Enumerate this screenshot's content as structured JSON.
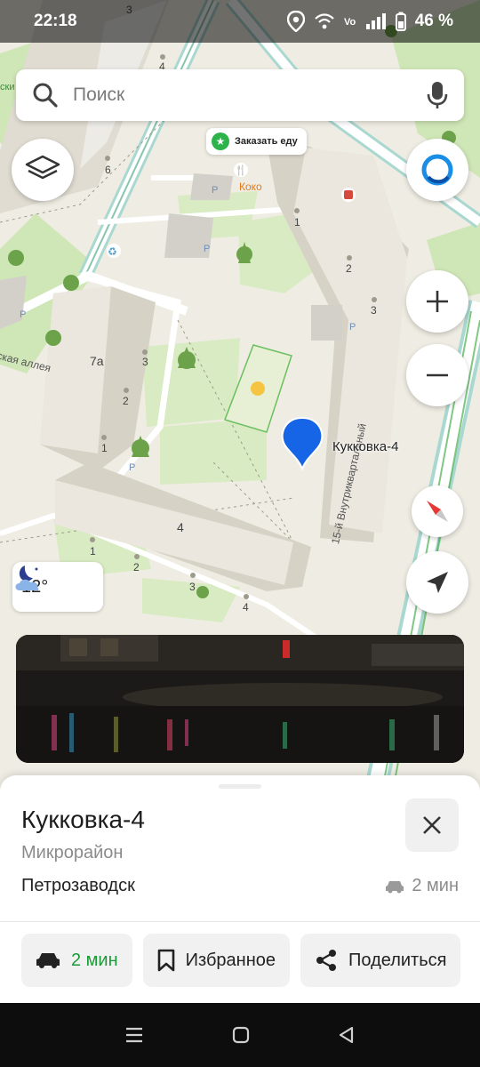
{
  "status_bar": {
    "time": "22:18",
    "battery": "46 %"
  },
  "search": {
    "placeholder": "Поиск"
  },
  "map": {
    "poi_food_chip": "Заказать еду",
    "poi_koko": "Коко",
    "street_alley": "ская аллея",
    "street_vnutrikvartalny": "15-й Внутриквартальный",
    "building_7a": "7а",
    "building_4": "4",
    "house_numbers": {
      "n_top_3": "3",
      "n_top_4": "4",
      "n_6": "6",
      "n_r1": "1",
      "n_r2": "2",
      "n_r3": "3",
      "n_7a_3": "3",
      "n_7a_2": "2",
      "n_7a_1": "1",
      "n_b4_1": "1",
      "n_b4_2": "2",
      "n_b4_3": "3",
      "n_b4_4": "4"
    },
    "partial_label_left": "ски",
    "pin_label": "Кукковка-4",
    "weather_temp": "12°"
  },
  "place_card": {
    "title": "Кукковка-4",
    "type": "Микрорайон",
    "city": "Петрозаводск",
    "eta": "2 мин"
  },
  "actions": {
    "route_label": "2 мин",
    "favorites_label": "Избранное",
    "share_label": "Поделиться"
  },
  "colors": {
    "accent_green": "#1a9b38",
    "pin_blue": "#1565e6",
    "compass_red": "#e53935"
  }
}
